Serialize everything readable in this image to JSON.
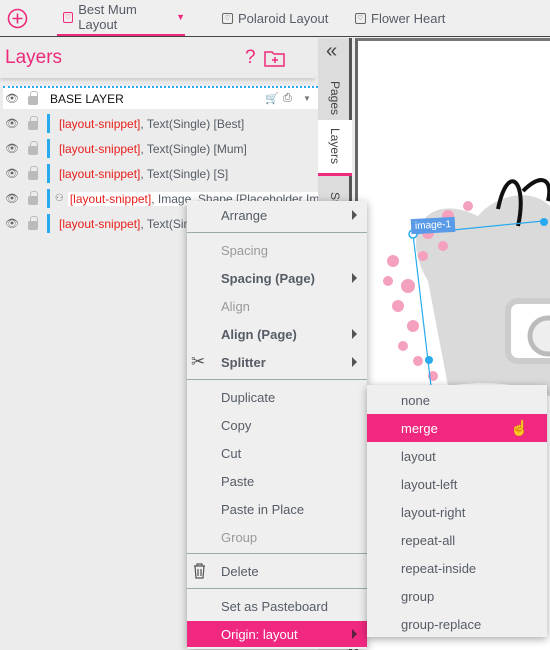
{
  "topbar": {
    "add_icon": "plus-circle-icon",
    "tabs": [
      {
        "label": "Best Mum Layout",
        "active": true
      },
      {
        "label": "Polaroid Layout"
      },
      {
        "label": "Flower Heart"
      }
    ]
  },
  "layers_panel": {
    "title": "Layers",
    "help_icon": "question-icon",
    "add_folder_icon": "folder-plus-icon",
    "base_layer": {
      "label": "BASE LAYER",
      "icons": [
        "cart-icon",
        "print-icon",
        "caret-down-icon"
      ]
    },
    "items": [
      {
        "tag": "[layout-snippet]",
        "desc": ", Text(Single) [Best]"
      },
      {
        "tag": "[layout-snippet]",
        "desc": ", Text(Single) [Mum]"
      },
      {
        "tag": "[layout-snippet]",
        "desc": ", Text(Single) [S]"
      },
      {
        "tag": "[layout-snippet]",
        "desc": ", Image, Shape [Placeholder Ima"
      },
      {
        "tag": "[layout-snippet]",
        "desc": ", Text(Sing"
      }
    ]
  },
  "side_tabs": {
    "collapse": "«",
    "pages": "Pages",
    "layers": "Layers",
    "styles": "St"
  },
  "canvas": {
    "selection_label": "image-1"
  },
  "context_menu": {
    "items": [
      {
        "label": "Arrange",
        "submenu": true
      },
      {
        "label": "Spacing",
        "disabled": true
      },
      {
        "label": "Spacing (Page)",
        "bold": true,
        "submenu": true
      },
      {
        "label": "Align",
        "disabled": true
      },
      {
        "label": "Align (Page)",
        "bold": true,
        "submenu": true
      },
      {
        "label": "Splitter",
        "bold": true,
        "submenu": true,
        "icon": "scissors-icon"
      },
      {
        "label": "Duplicate"
      },
      {
        "label": "Copy"
      },
      {
        "label": "Cut"
      },
      {
        "label": "Paste"
      },
      {
        "label": "Paste in Place"
      },
      {
        "label": "Group",
        "disabled": true
      },
      {
        "label": "Delete",
        "icon": "trash-icon"
      },
      {
        "label": "Set as Pasteboard"
      },
      {
        "label": "Origin: layout",
        "highlighted": true,
        "submenu": true
      }
    ]
  },
  "origin_submenu": {
    "items": [
      "none",
      "merge",
      "layout",
      "layout-left",
      "layout-right",
      "repeat-all",
      "repeat-inside",
      "group",
      "group-replace"
    ],
    "highlighted": "merge"
  },
  "colors": {
    "accent": "#ee2a7b",
    "layer_bar": "#29aaef",
    "tag": "#e8201c"
  }
}
